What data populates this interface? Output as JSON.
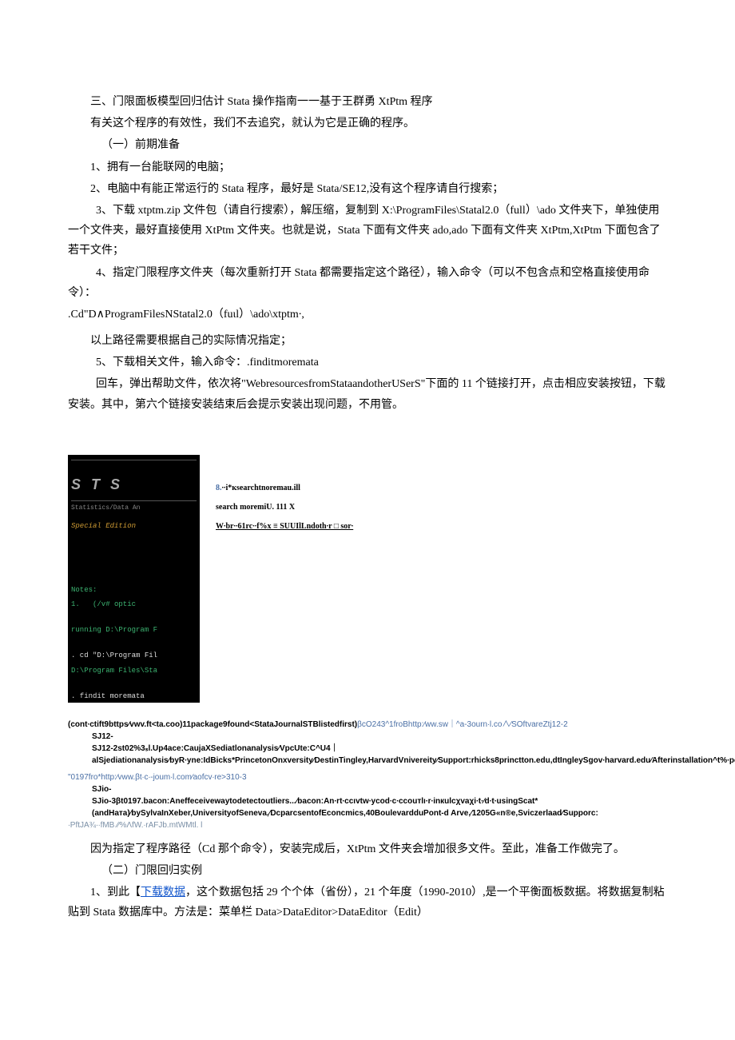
{
  "title_line": "三、门限面板模型回归估计 Stata 操作指南一一基于王群勇 XtPtm 程序",
  "p_intro": "有关这个程序的有效性，我们不去追究，就认为它是正确的程序。",
  "sec1_title": "（一）前期准备",
  "p1": "1、拥有一台能联网的电脑；",
  "p2": "2、电脑中有能正常运行的 Stata 程序，最好是 Stata/SE12,没有这个程序请自行搜索；",
  "p3": "3、下载 xtptm.zip 文件包（请自行搜索），解压缩，复制到 X:\\ProgramFiles\\Statal2.0（full）\\ado 文件夹下，单独使用一个文件夹，最好直接使用 XtPtm 文件夹。也就是说，Stata 下面有文件夹 ado,ado 下面有文件夹 XtPtm,XtPtm 下面包含了若干文件；",
  "p4": "4、指定门限程序文件夹（每次重新打开 Stata 都需要指定这个路径），输入命令（可以不包含点和空格直接使用命令）：",
  "cmd1": ".Cd\"D∧ProgramFilesNStatal2.0（fuιl）\\ado\\xtptm∙,",
  "p5": "以上路径需要根据自己的实际情况指定；",
  "p6": "5、下载相关文件，输入命令：.finditmoremata",
  "p7": "回车，弹出帮助文件，依次将\"WebresourcesfromStataandotherUSerS\"下面的 11 个链接打开，点击相应安装按钮，下载安装。其中，第六个链接安装结束后会提示安装出现问题，不用管。",
  "stata": {
    "logo_letters": "S T S",
    "sub": "Statistics/Data An",
    "edition": "Special Edition",
    "notes": "Notes:",
    "notes1": "1.   (/v# optic",
    "run": "running D:\\Program F",
    "cd": ". cd \"D:\\Program Fil",
    "cdres": "D:\\Program Files\\Sta",
    "findit": ". findit moremata"
  },
  "side": {
    "l1_num": "8.",
    "l1": "∙∙i*кsearchtnoremau.ill",
    "l2": "search moremiU. 111 X",
    "l3": "W∙br∙∙61rc∙∙f%x ≡ SUUIlLndoth∙r □ sor∙"
  },
  "refs": {
    "r1a": "(cont∙ctift9bttps∕vwv.ft<ta.coo)11package9found<StataJournalSTBlistedfirst)",
    "r1b": "βcO243^1froBhttp:∕ww.sw｜^a-3ourn∙l.co∧∕SOftvareZtj12-2",
    "r2": "SJ12-2st02%3ₛl.Up4ace:CaujaXSediatlonanalysis∕VpcUte:C^U4｜alSjediationanalysis∕byR∙yne:IdBicks*PrincetonOnxversity∕DestinTingley,HarvardVnivereity∕Support:rhicks8princtton.edu,dtIngleySgov∙harvard.edu∕Afterinstallation^t%∙pehelpsedeffand",
    "r3": "\"0197fro*http:∕vww.βt∙c∙-joum∙l.com∕aofcv∙re>310-3",
    "r4": "SJio-3βt0197.bacon:Aneffeceivewaytodetectoutliers...∕bacon:An∙rt∙ccıvtw∙ycod∙c∙ccouтlı∙r∙inкulcχvaχi∙t∙∕d∙t∙usingScat*(andHaтa)∕bySylvaInXeber,UniversityofSeneva,∕DcparcsentofEconcmics,40BoulevardduPont-d Arve,∕1205G«n®e,Sviczerlaad∕Supporc:",
    "r5": "∙PftJA¾∙∙fMB  ∕∕%ΛfW.∙rAFJb.mtWMtl.          l"
  },
  "p8": "因为指定了程序路径（Cd 那个命令），安装完成后，XtPtm 文件夹会增加很多文件。至此，准备工作做完了。",
  "sec2_title": "（二）门限回归实例",
  "p9a": "1、到此【",
  "p9link": "下载数据",
  "p9b": "，这个数据包括 29 个个体（省份），21 个年度（1990-2010）,是一个平衡面板数据。将数据复制粘贴到 Stata 数据库中。方法是：菜单栏 Data>DataEditor>DataEditor（Edit）"
}
